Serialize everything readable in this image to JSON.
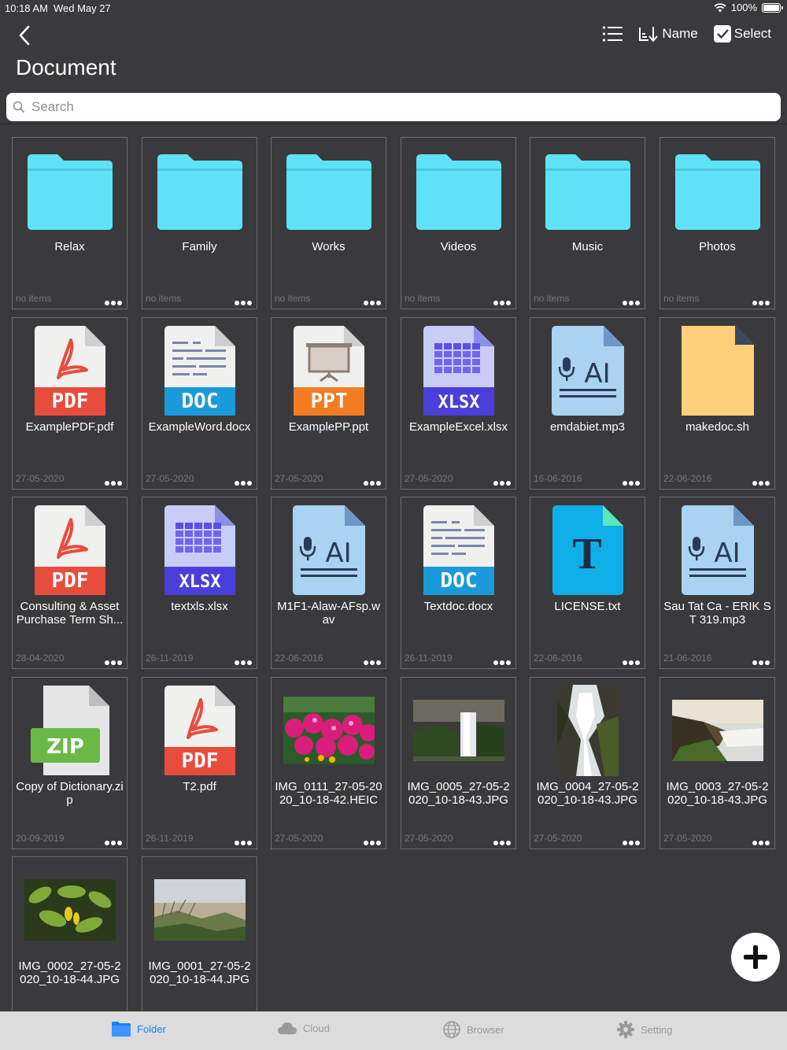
{
  "status": {
    "time": "10:18 AM",
    "date": "Wed May 27",
    "battery": "100%"
  },
  "nav": {
    "name_label": "Name",
    "select_label": "Select"
  },
  "title": "Document",
  "search": {
    "placeholder": "Search"
  },
  "items": [
    {
      "type": "folder",
      "name": "Relax",
      "meta": "no items"
    },
    {
      "type": "folder",
      "name": "Family",
      "meta": "no items"
    },
    {
      "type": "folder",
      "name": "Works",
      "meta": "no items"
    },
    {
      "type": "folder",
      "name": "Videos",
      "meta": "no items"
    },
    {
      "type": "folder",
      "name": "Music",
      "meta": "no items"
    },
    {
      "type": "folder",
      "name": "Photos",
      "meta": "no items"
    },
    {
      "type": "pdf",
      "name": "ExamplePDF.pdf",
      "meta": "27-05-2020",
      "label": "PDF"
    },
    {
      "type": "doc",
      "name": "ExampleWord.docx",
      "meta": "27-05-2020",
      "label": "DOC"
    },
    {
      "type": "ppt",
      "name": "ExamplePP.ppt",
      "meta": "27-05-2020",
      "label": "PPT"
    },
    {
      "type": "xlsx",
      "name": "ExampleExcel.xlsx",
      "meta": "27-05-2020",
      "label": "XLSX"
    },
    {
      "type": "audio",
      "name": "emdabiet.mp3",
      "meta": "16-06-2016",
      "label": "AI"
    },
    {
      "type": "sh",
      "name": "makedoc.sh",
      "meta": "22-06-2016"
    },
    {
      "type": "pdf",
      "name": "Consulting & Asset Purchase Term Sh...",
      "meta": "28-04-2020",
      "label": "PDF"
    },
    {
      "type": "xlsx",
      "name": "textxls.xlsx",
      "meta": "26-11-2019",
      "label": "XLSX"
    },
    {
      "type": "audio",
      "name": "M1F1-Alaw-AFsp.wav",
      "meta": "22-06-2016",
      "label": "AI"
    },
    {
      "type": "doc",
      "name": "Textdoc.docx",
      "meta": "26-11-2019",
      "label": "DOC"
    },
    {
      "type": "txt",
      "name": "LICENSE.txt",
      "meta": "22-06-2016",
      "label": "T"
    },
    {
      "type": "audio",
      "name": "Sau Tat Ca - ERIK ST 319.mp3",
      "meta": "21-06-2016",
      "label": "AI"
    },
    {
      "type": "zip",
      "name": "Copy of Dictionary.zip",
      "meta": "20-09-2019",
      "label": "ZIP"
    },
    {
      "type": "pdf",
      "name": "T2.pdf",
      "meta": "26-11-2019",
      "label": "PDF"
    },
    {
      "type": "photo",
      "name": "IMG_0111_27-05-2020_10-18-42.HEIC",
      "meta": "27-05-2020",
      "scene": "flowers"
    },
    {
      "type": "photo",
      "name": "IMG_0005_27-05-2020_10-18-43.JPG",
      "meta": "27-05-2020",
      "scene": "waterfall"
    },
    {
      "type": "photo",
      "name": "IMG_0004_27-05-2020_10-18-43.JPG",
      "meta": "27-05-2020",
      "scene": "stream"
    },
    {
      "type": "photo",
      "name": "IMG_0003_27-05-2020_10-18-43.JPG",
      "meta": "27-05-2020",
      "scene": "cliff"
    },
    {
      "type": "photo",
      "name": "IMG_0002_27-05-2020_10-18-44.JPG",
      "meta": "",
      "scene": "leaves"
    },
    {
      "type": "photo",
      "name": "IMG_0001_27-05-2020_10-18-44.JPG",
      "meta": "",
      "scene": "dunes"
    }
  ],
  "tabs": [
    {
      "label": "Folder",
      "icon": "folder-icon",
      "active": true
    },
    {
      "label": "Cloud",
      "icon": "cloud-icon",
      "active": false
    },
    {
      "label": "Browser",
      "icon": "globe-icon",
      "active": false
    },
    {
      "label": "Setting",
      "icon": "gear-icon",
      "active": false
    }
  ],
  "colors": {
    "folder": "#5ee2f7",
    "pdf": "#e84c3d",
    "doc": "#1b9ad9",
    "ppt": "#f37b21",
    "xlsx": "#4a3fd8",
    "audio_page": "#a9d3f0",
    "sh": "#ffcf7a",
    "txt": "#10aee6",
    "zip": "#6ab946",
    "accent": "#1a7ef5"
  }
}
